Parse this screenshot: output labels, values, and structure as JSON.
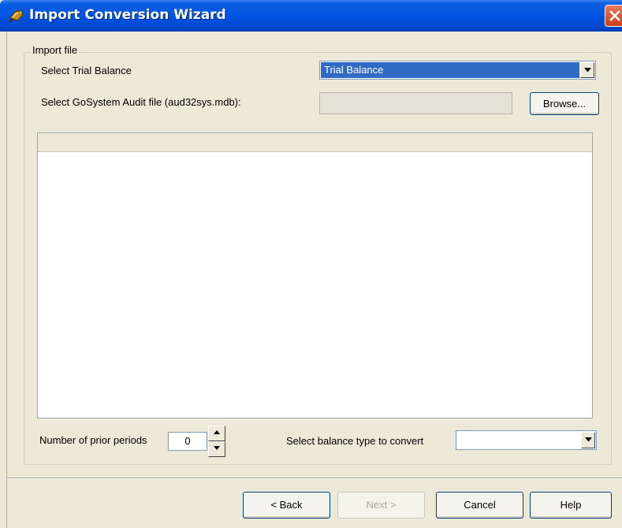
{
  "window": {
    "title": "Import Conversion Wizard",
    "icon": "wizard-app-icon",
    "close_icon": "close-icon"
  },
  "import_file": {
    "legend": "Import file",
    "trial_balance_label": "Select Trial Balance",
    "trial_balance_value": "Trial Balance",
    "audit_file_label": "Select GoSystem Audit file (aud32sys.mdb):",
    "audit_file_value": "",
    "browse_label": "Browse...",
    "prior_periods_label": "Number of prior periods",
    "prior_periods_value": "0",
    "balance_type_label": "Select balance type to convert",
    "balance_type_value": ""
  },
  "footer": {
    "back_label": "< Back",
    "next_label": "Next >",
    "cancel_label": "Cancel",
    "help_label": "Help"
  },
  "colors": {
    "titlebar": "#0054e3",
    "dialog_bg": "#ece9d8",
    "selection": "#316ac5"
  }
}
